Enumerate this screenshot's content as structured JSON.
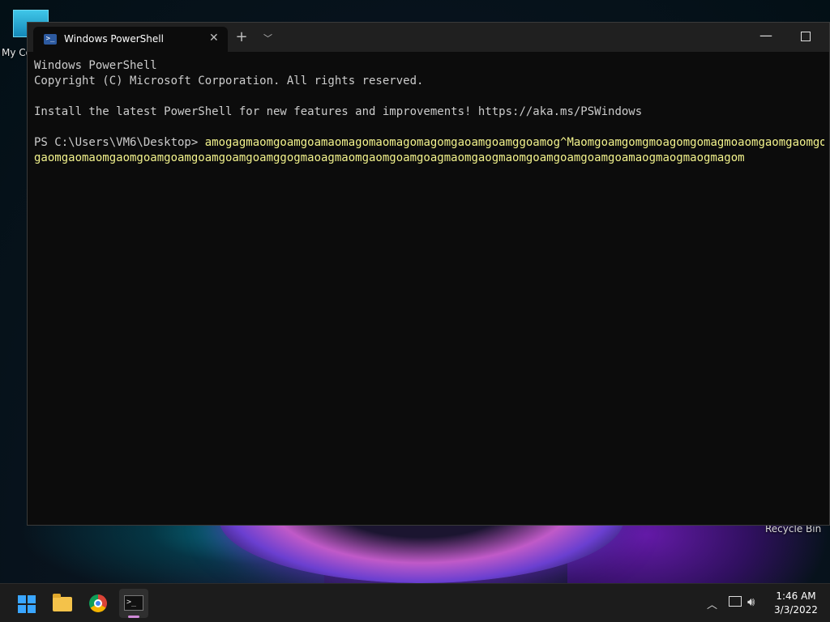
{
  "desktop": {
    "icon_label": "My Co",
    "recycle_bin_label": "Recycle Bin"
  },
  "window": {
    "tab_title": "Windows PowerShell"
  },
  "console": {
    "line1": "Windows PowerShell",
    "line2": "Copyright (C) Microsoft Corporation. All rights reserved.",
    "line3": "Install the latest PowerShell for new features and improvements! https://aka.ms/PSWindows",
    "prompt": "PS C:\\Users\\VM6\\Desktop> ",
    "command_line1": "amogagmaomgoamgoamaomagomaomagomagomgaoamgoamggoamog^Maomgoamgomgmoagomgomagmoaomgaomgaomgoam",
    "command_line2": "gaomgaomaomgaomgoamgoamgoamgoamgoamggogmaoagmaomgaomgoamgoagmaomgaogmaomgoamgoamgoamgoamaogmaogmaogmagom"
  },
  "taskbar": {
    "clock_time": "1:46 AM",
    "clock_date": "3/3/2022"
  }
}
